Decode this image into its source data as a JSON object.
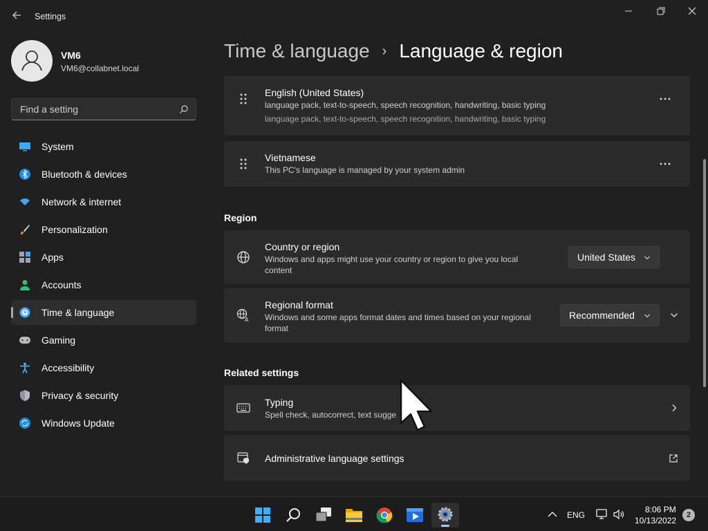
{
  "window": {
    "title": "Settings"
  },
  "user": {
    "name": "VM6",
    "email": "VM6@collabnet.local"
  },
  "search": {
    "placeholder": "Find a setting"
  },
  "sidebar": {
    "items": [
      {
        "label": "System",
        "icon": "monitor-icon"
      },
      {
        "label": "Bluetooth & devices",
        "icon": "bluetooth-icon"
      },
      {
        "label": "Network & internet",
        "icon": "wifi-icon"
      },
      {
        "label": "Personalization",
        "icon": "brush-icon"
      },
      {
        "label": "Apps",
        "icon": "apps-icon"
      },
      {
        "label": "Accounts",
        "icon": "person-icon"
      },
      {
        "label": "Time & language",
        "icon": "clock-globe-icon",
        "active": true
      },
      {
        "label": "Gaming",
        "icon": "gamepad-icon"
      },
      {
        "label": "Accessibility",
        "icon": "accessibility-icon"
      },
      {
        "label": "Privacy & security",
        "icon": "shield-icon"
      },
      {
        "label": "Windows Update",
        "icon": "update-icon"
      }
    ]
  },
  "breadcrumb": {
    "parent": "Time & language",
    "separator": "›",
    "current": "Language & region"
  },
  "languages": [
    {
      "name": "English (United States)",
      "detail": "language pack, text-to-speech, speech recognition, handwriting, basic typing",
      "detail_ghost": "language pack, text-to-speech, speech recognition, handwriting, basic typing"
    },
    {
      "name": "Vietnamese",
      "detail": "This PC's language is managed by your system admin"
    }
  ],
  "region": {
    "section_title": "Region",
    "country": {
      "title": "Country or region",
      "desc_line1": "Windows and apps might use your country or region to give you local",
      "desc_line2": "content",
      "value": "United States"
    },
    "format": {
      "title": "Regional format",
      "desc_line1": "Windows and some apps format dates and times based on your regional",
      "desc_line2": "format",
      "value": "Recommended"
    }
  },
  "related": {
    "section_title": "Related settings",
    "typing": {
      "title": "Typing",
      "desc": "Spell check, autocorrect, text sugge"
    },
    "admin": {
      "title": "Administrative language settings"
    }
  },
  "taskbar": {
    "apps": [
      "windows-start-icon",
      "search-icon",
      "task-view-icon",
      "file-explorer-icon",
      "chrome-icon",
      "media-app-icon",
      "settings-icon"
    ],
    "language": "ENG",
    "time": "8:06 PM",
    "date": "10/13/2022",
    "notifications": "2"
  },
  "colors": {
    "background": "#202020",
    "card": "#2b2b2b",
    "accent": "#4cc2ff"
  }
}
